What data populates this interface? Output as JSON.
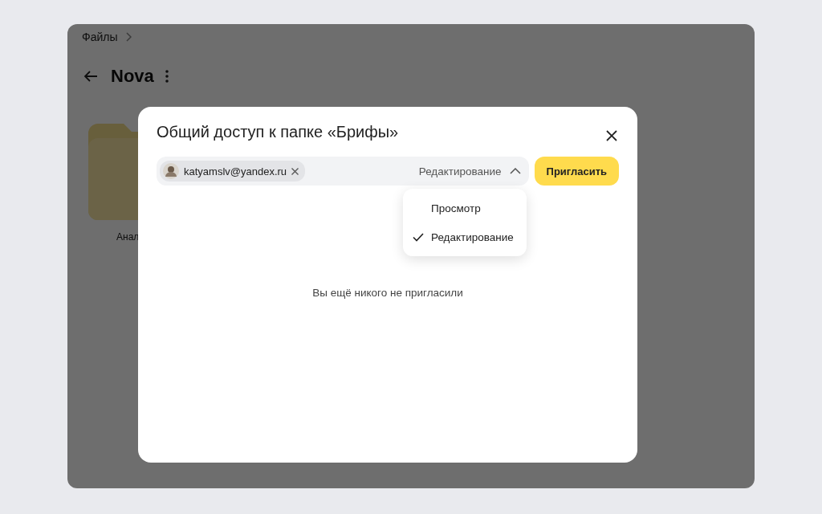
{
  "background": {
    "breadcrumb": "Файлы",
    "title": "Nova",
    "folders": [
      {
        "label": "Анал"
      }
    ]
  },
  "dialog": {
    "title": "Общий доступ к папке «Брифы»",
    "invitees": [
      {
        "email": "katyamslv@yandex.ru"
      }
    ],
    "access": {
      "value": "Редактирование",
      "expanded": true,
      "options": [
        {
          "label": "Просмотр",
          "selected": false
        },
        {
          "label": "Редактирование",
          "selected": true
        }
      ]
    },
    "invite_button": "Пригласить",
    "empty_text": "Вы ещё никого не пригласили"
  }
}
